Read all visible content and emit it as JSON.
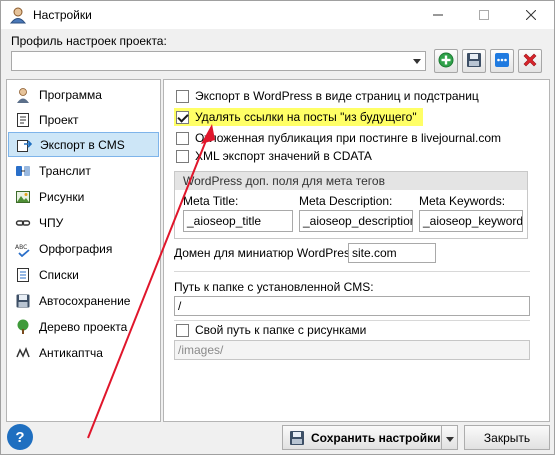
{
  "window": {
    "title": "Настройки"
  },
  "profile": {
    "label": "Профиль настроек проекта:",
    "value": ""
  },
  "sidebar": {
    "items": [
      {
        "label": "Программа",
        "icon": "person-icon"
      },
      {
        "label": "Проект",
        "icon": "document-icon"
      },
      {
        "label": "Экспорт в CMS",
        "icon": "export-icon"
      },
      {
        "label": "Транслит",
        "icon": "translit-icon"
      },
      {
        "label": "Рисунки",
        "icon": "images-icon"
      },
      {
        "label": "ЧПУ",
        "icon": "link-icon"
      },
      {
        "label": "Орфография",
        "icon": "spelling-icon"
      },
      {
        "label": "Списки",
        "icon": "list-icon"
      },
      {
        "label": "Автосохранение",
        "icon": "autosave-icon"
      },
      {
        "label": "Дерево проекта",
        "icon": "tree-icon"
      },
      {
        "label": "Антикаптча",
        "icon": "anticaptcha-icon"
      }
    ],
    "active_index": 2
  },
  "export": {
    "options": [
      {
        "label": "Экспорт в WordPress в виде страниц и подстраниц",
        "checked": false
      },
      {
        "label": "Удалять ссылки на посты \"из будущего\"",
        "checked": true
      },
      {
        "label": "Отложенная публикация при постинге в livejournal.com",
        "checked": false
      },
      {
        "label": "XML экспорт значений в CDATA",
        "checked": false
      }
    ],
    "meta_group": {
      "title": "WordPress доп. поля для мета тегов",
      "title_label": "Meta Title:",
      "title_value": "_aioseop_title",
      "description_label": "Meta Description:",
      "description_value": "_aioseop_description",
      "keywords_label": "Meta Keywords:",
      "keywords_value": "_aioseop_keywords"
    },
    "thumb_domain_label": "Домен для миниатюр WordPress:",
    "thumb_domain_value": "site.com",
    "cms_path_label": "Путь к папке с установленной CMS:",
    "cms_path_value": "/",
    "custom_images_label": "Свой путь к папке с рисунками",
    "images_path_value": "/images/"
  },
  "footer": {
    "help_label": "?",
    "save_label": "Сохранить настройки",
    "close_label": "Закрыть"
  },
  "colors": {
    "accent": "#1f6fc0",
    "highlight": "#ffff66",
    "annotation_arrow": "#e0162b",
    "active_item": "#cde6f7"
  }
}
